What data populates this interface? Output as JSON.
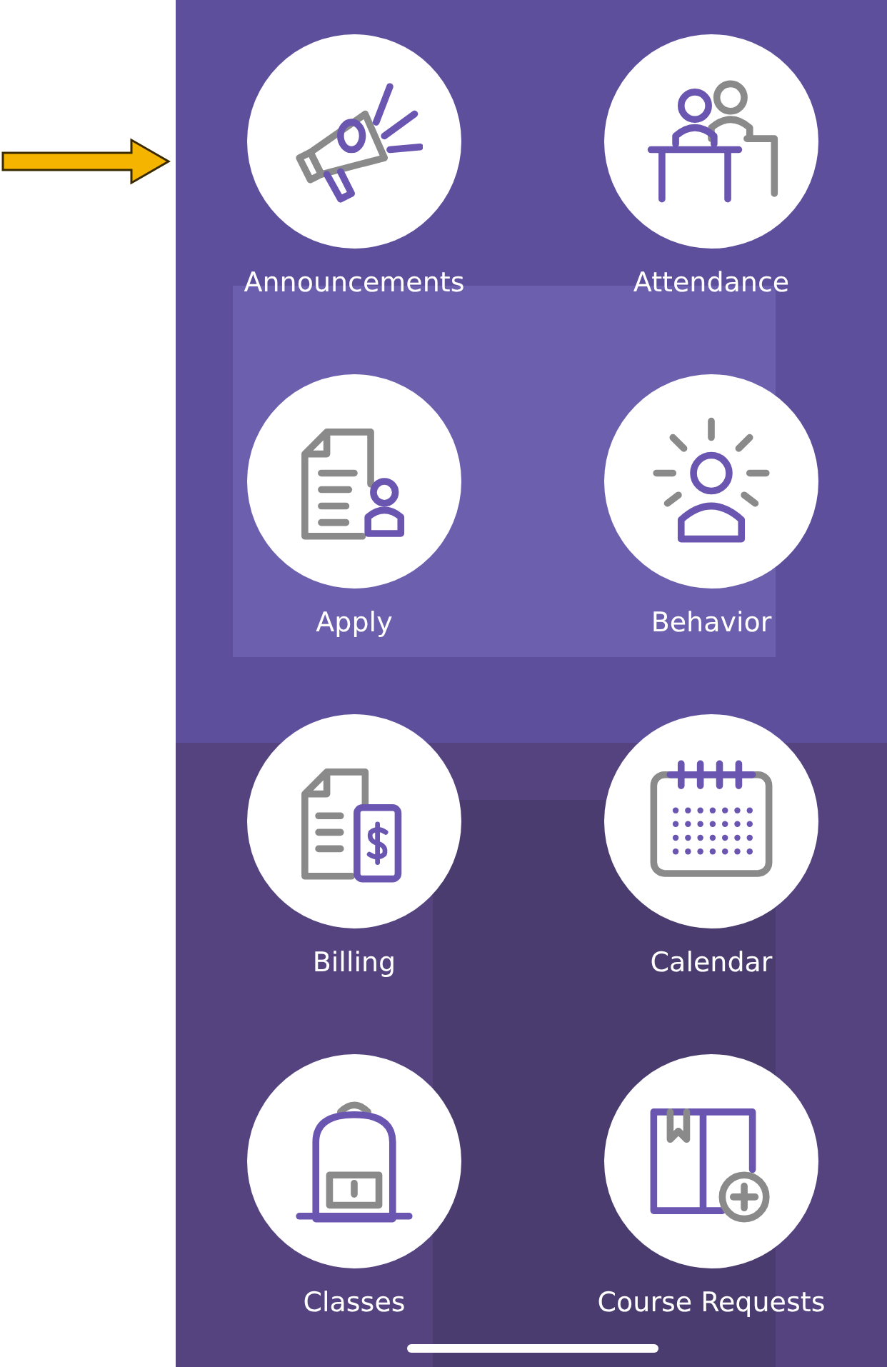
{
  "tiles": [
    {
      "label": "Announcements",
      "kind": "megaphone"
    },
    {
      "label": "Attendance",
      "kind": "desk"
    },
    {
      "label": "Apply",
      "kind": "application"
    },
    {
      "label": "Behavior",
      "kind": "person-rays"
    },
    {
      "label": "Billing",
      "kind": "bill-phone"
    },
    {
      "label": "Calendar",
      "kind": "calendar"
    },
    {
      "label": "Classes",
      "kind": "backpack"
    },
    {
      "label": "Course Requests",
      "kind": "book-plus"
    }
  ]
}
